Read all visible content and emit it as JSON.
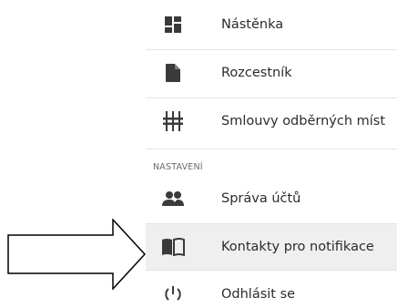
{
  "menu": {
    "items": [
      {
        "label": "Nástěnka",
        "icon": "dashboard-icon"
      },
      {
        "label": "Rozcestník",
        "icon": "document-icon"
      },
      {
        "label": "Smlouvy odběrných míst",
        "icon": "meter-icon"
      }
    ],
    "section_header": "NASTAVENÍ",
    "settings_items": [
      {
        "label": "Správa účtů",
        "icon": "people-icon"
      },
      {
        "label": "Kontakty pro notifikace",
        "icon": "book-icon",
        "selected": true
      },
      {
        "label": "Odhlásit se",
        "icon": "power-icon"
      }
    ]
  },
  "annotation": {
    "icon": "arrow-right-outline-icon"
  },
  "colors": {
    "icon": "#3a3a3a",
    "text": "#2b2b2b",
    "selected_bg": "#efefef",
    "divider": "#e4e4e4",
    "section_header": "#6b6b6b"
  }
}
